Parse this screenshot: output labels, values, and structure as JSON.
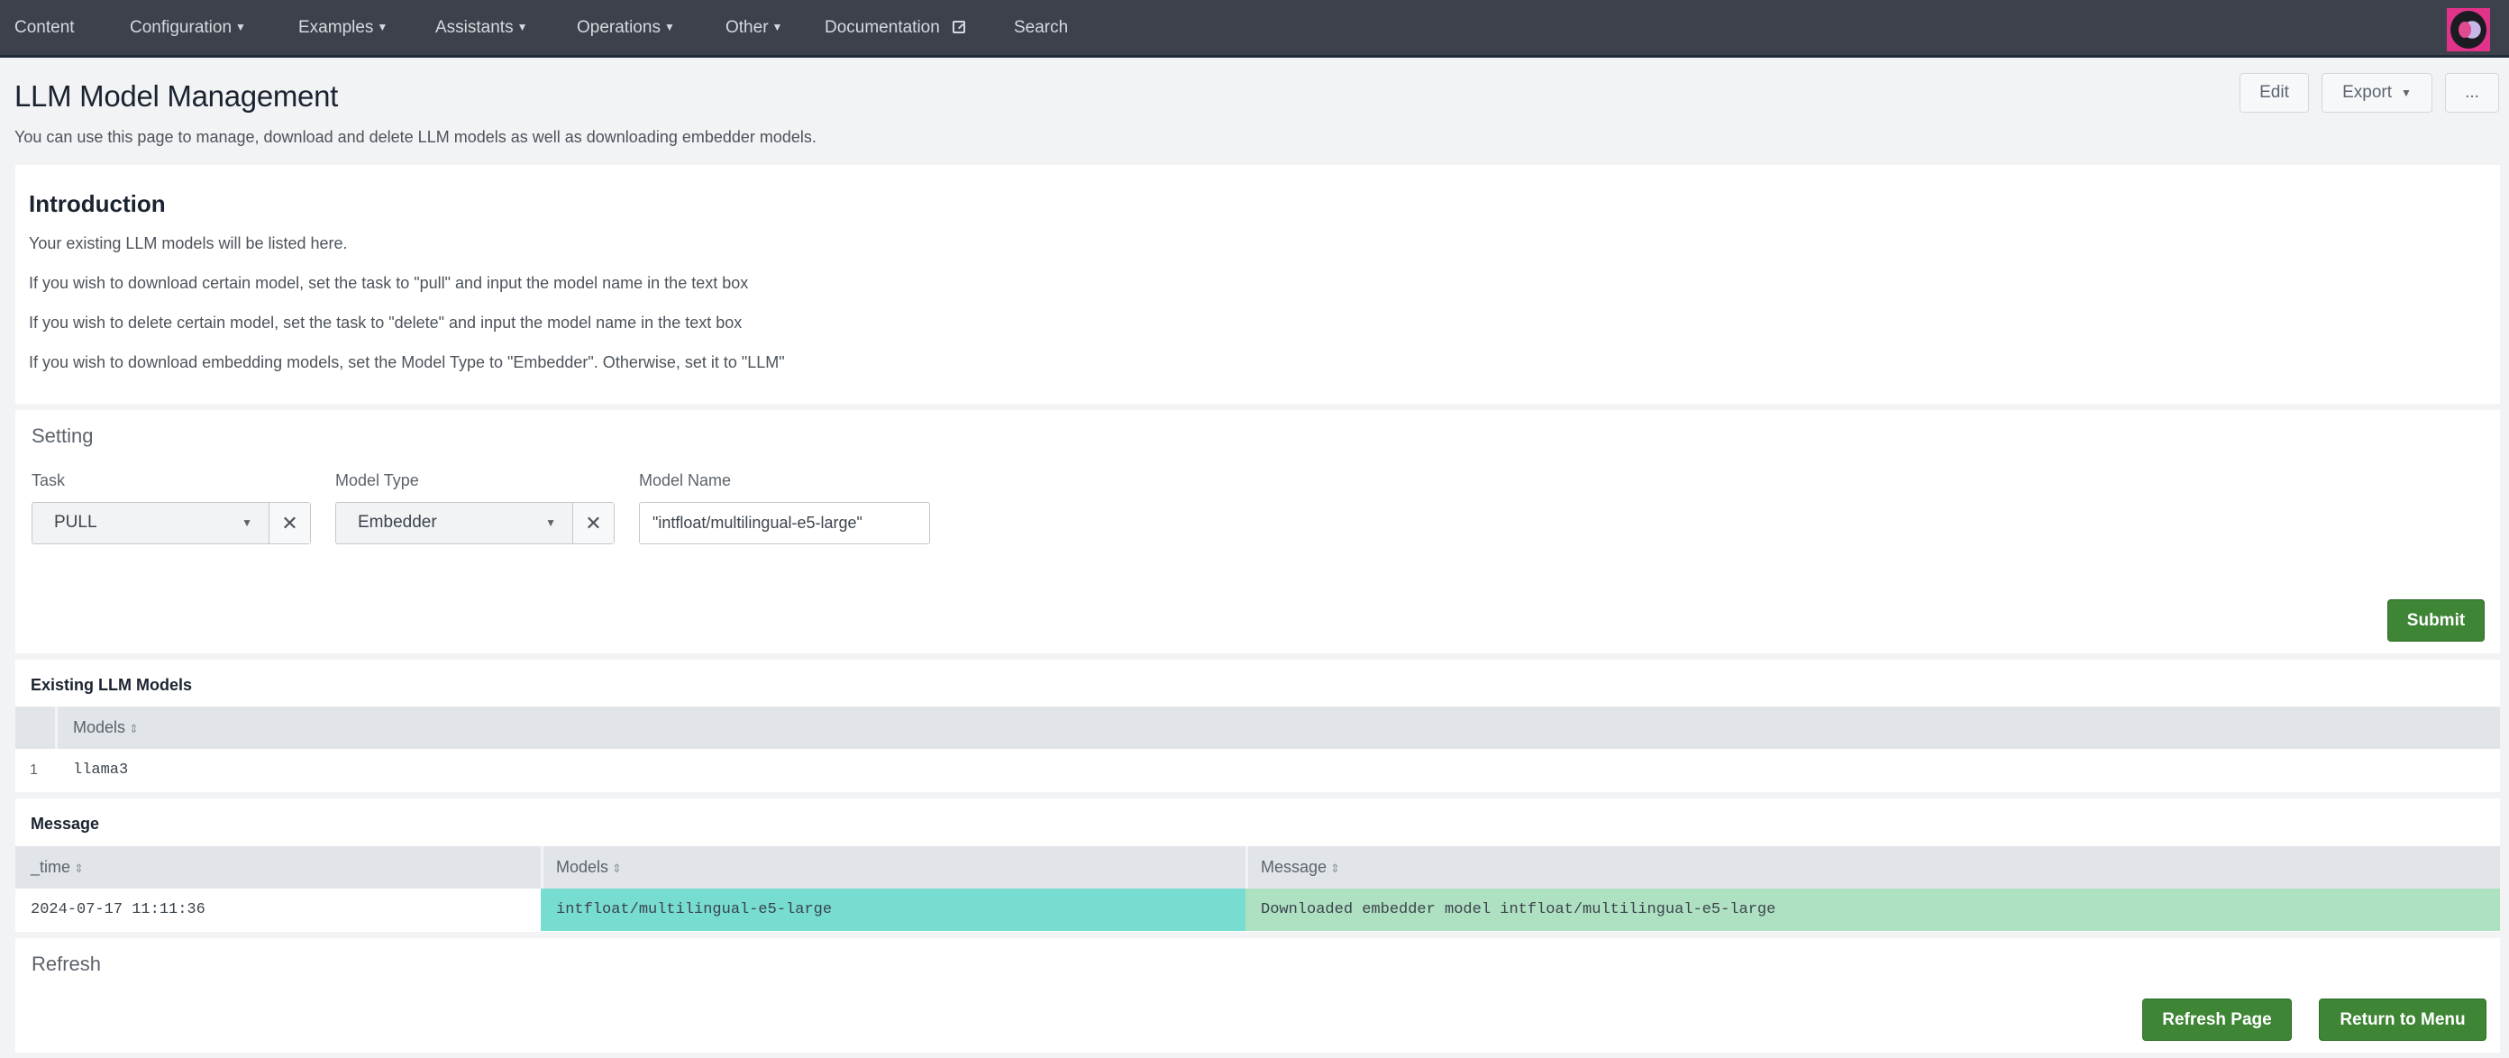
{
  "nav": {
    "items": [
      {
        "label": "Content",
        "dropdown": false
      },
      {
        "label": "Configuration",
        "dropdown": true
      },
      {
        "label": "Examples",
        "dropdown": true
      },
      {
        "label": "Assistants",
        "dropdown": true
      },
      {
        "label": "Operations",
        "dropdown": true
      },
      {
        "label": "Other",
        "dropdown": true
      },
      {
        "label": "Documentation",
        "external": true
      },
      {
        "label": "Search",
        "dropdown": false
      }
    ],
    "caret": "▼"
  },
  "header": {
    "title": "LLM Model Management",
    "description": "You can use this page to manage, download and delete LLM models as well as downloading embedder models.",
    "edit_label": "Edit",
    "export_label": "Export",
    "more_label": "..."
  },
  "intro": {
    "title": "Introduction",
    "lines": [
      "Your existing LLM models will be listed here.",
      "If you wish to download certain model, set the task to \"pull\" and input the model name in the text box",
      "If you wish to delete certain model, set the task to \"delete\" and input the model name in the text box",
      "If you wish to download embedding models, set the Model Type to \"Embedder\". Otherwise, set it to \"LLM\""
    ]
  },
  "setting": {
    "title": "Setting",
    "task": {
      "label": "Task",
      "value": "PULL"
    },
    "model_type": {
      "label": "Model Type",
      "value": "Embedder"
    },
    "model_name": {
      "label": "Model Name",
      "value": "\"intfloat/multilingual-e5-large\""
    },
    "clear_glyph": "✕",
    "submit_label": "Submit"
  },
  "existing": {
    "title": "Existing LLM Models",
    "columns": [
      "Models"
    ],
    "rows": [
      {
        "index": "1",
        "models": "llama3"
      }
    ]
  },
  "message": {
    "title": "Message",
    "columns": [
      "_time",
      "Models",
      "Message"
    ],
    "rows": [
      {
        "_time": "2024-07-17 11:11:36",
        "models": "intfloat/multilingual-e5-large",
        "message": "Downloaded embedder model intfloat/multilingual-e5-large"
      }
    ],
    "cell_colors": {
      "models": "#76ddd0",
      "message": "#aee0c2"
    }
  },
  "refresh": {
    "title": "Refresh",
    "refresh_label": "Refresh Page",
    "return_label": "Return to Menu"
  },
  "sort_glyph": "⇕",
  "colors": {
    "nav_bg": "#3c414b",
    "button_green": "#3e8535",
    "page_bg": "#f2f3f5"
  }
}
